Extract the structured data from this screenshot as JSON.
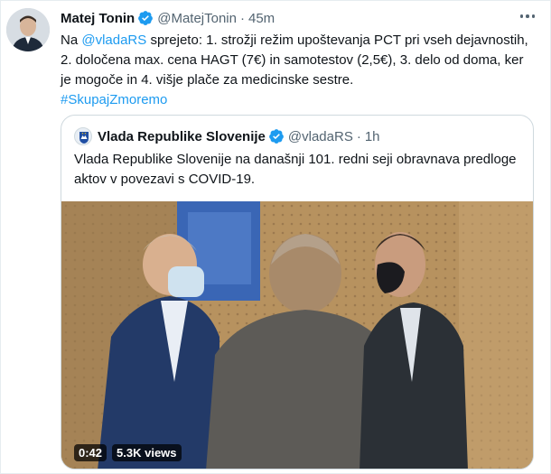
{
  "author": {
    "name": "Matej Tonin",
    "handle": "@MatejTonin",
    "time": "45m"
  },
  "tweet": {
    "text_intro": "Na ",
    "mention": "@vladaRS",
    "text_body": " sprejeto: 1. strožji režim upoštevanja PCT pri vseh dejavnostih, 2. določena max. cena HAGT (7€) in samotestov (2,5€), 3. delo od doma, ker je mogoče in 4. višje plače za medicinske sestre.",
    "hashtag": "#SkupajZmoremo"
  },
  "quoted": {
    "name": "Vlada Republike Slovenije",
    "handle": "@vladaRS",
    "time": "1h",
    "text": "Vlada Republike Slovenije na današnji 101. redni seji obravnava predloge aktov v povezavi s COVID-19."
  },
  "video": {
    "duration": "0:42",
    "views": "5.3K views"
  },
  "icons": {
    "verified": "verified-badge-icon",
    "more": "more-options-icon"
  },
  "colors": {
    "accent": "#1d9bf0",
    "text": "#0f1419",
    "muted": "#536471"
  }
}
